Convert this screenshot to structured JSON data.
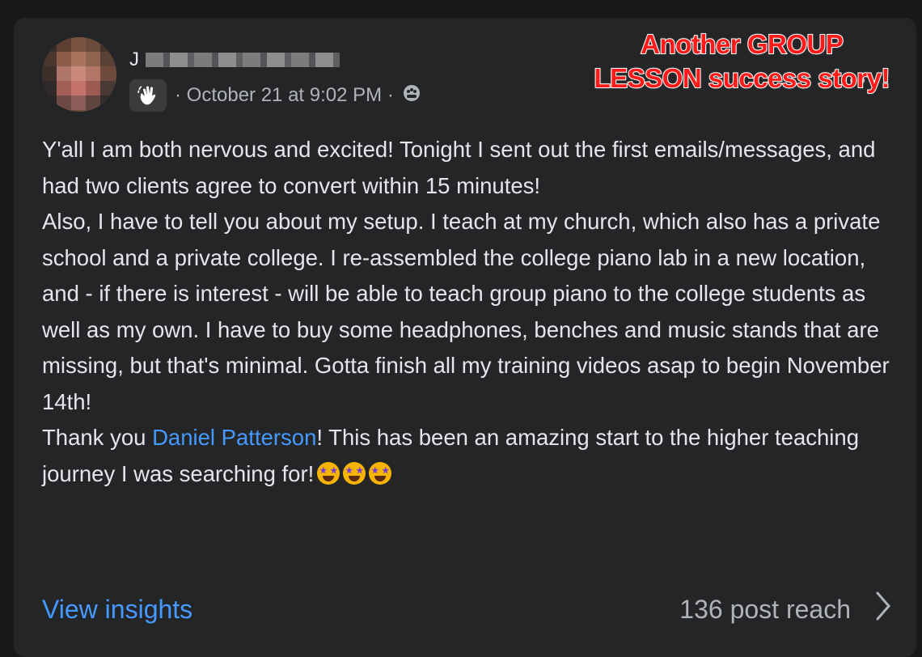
{
  "post": {
    "author_initial": "J",
    "timestamp": "October 21 at 9:02 PM",
    "separator": "·",
    "badge_icon": "waving-hand-icon",
    "audience_icon": "group-audience-icon",
    "menu_icon": "more-options-icon",
    "paragraphs": [
      "Y'all I am both nervous and excited! Tonight I sent out the first emails/messages, and had two clients agree to convert within 15 minutes!",
      "Also, I have to tell you about my setup. I teach at my church, which also has a private school and a private college. I re-assembled the college piano lab in a new location, and - if there is interest - will be able to teach group piano to the college students as well as my own. I have to buy some headphones, benches and music stands that are missing, but that's minimal.  Gotta finish all my training videos asap to begin November 14th!"
    ],
    "thanks_prefix": "Thank you ",
    "mention": "Daniel Patterson",
    "thanks_suffix": "! This has been an amazing start to the higher teaching journey I was searching for!",
    "emoji_count": 3
  },
  "overlay": {
    "line1": "Another GROUP",
    "line2": "LESSON success story!",
    "color": "#ff1a1a"
  },
  "footer": {
    "insights_label": "View insights",
    "reach_label": "136 post reach"
  },
  "colors": {
    "background": "#17181a",
    "card": "#242527",
    "link": "#4599ff",
    "text": "#e4e6eb",
    "muted": "#b0b3b8"
  }
}
